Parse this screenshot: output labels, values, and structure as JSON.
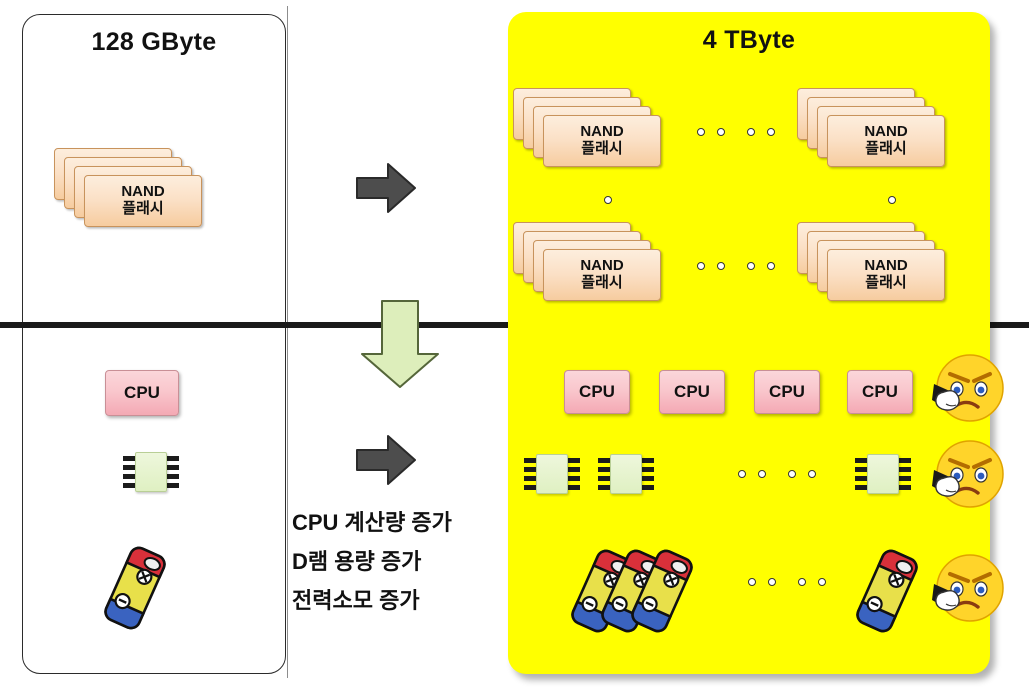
{
  "diagram": {
    "left_panel": {
      "title": "128 GByte",
      "nand_label_line1": "NAND",
      "nand_label_line2": "플래시",
      "cpu_label": "CPU"
    },
    "right_panel": {
      "title": "4 TByte",
      "nand_label_line1": "NAND",
      "nand_label_line2": "플래시",
      "cpu_labels": [
        "CPU",
        "CPU",
        "CPU",
        "CPU"
      ]
    },
    "notes": [
      "CPU 계산량 증가",
      "D램 용량 증가",
      "전력소모 증가"
    ],
    "colors": {
      "highlight_panel": "#ffff00",
      "nand_card": "#fbe0c6",
      "cpu_box": "#f9c7cd",
      "chip_body": "#dff0c2",
      "arrow_gray": "#4d4d4d",
      "arrow_green": "#ddeebb",
      "divider": "#1a1a1a"
    }
  }
}
